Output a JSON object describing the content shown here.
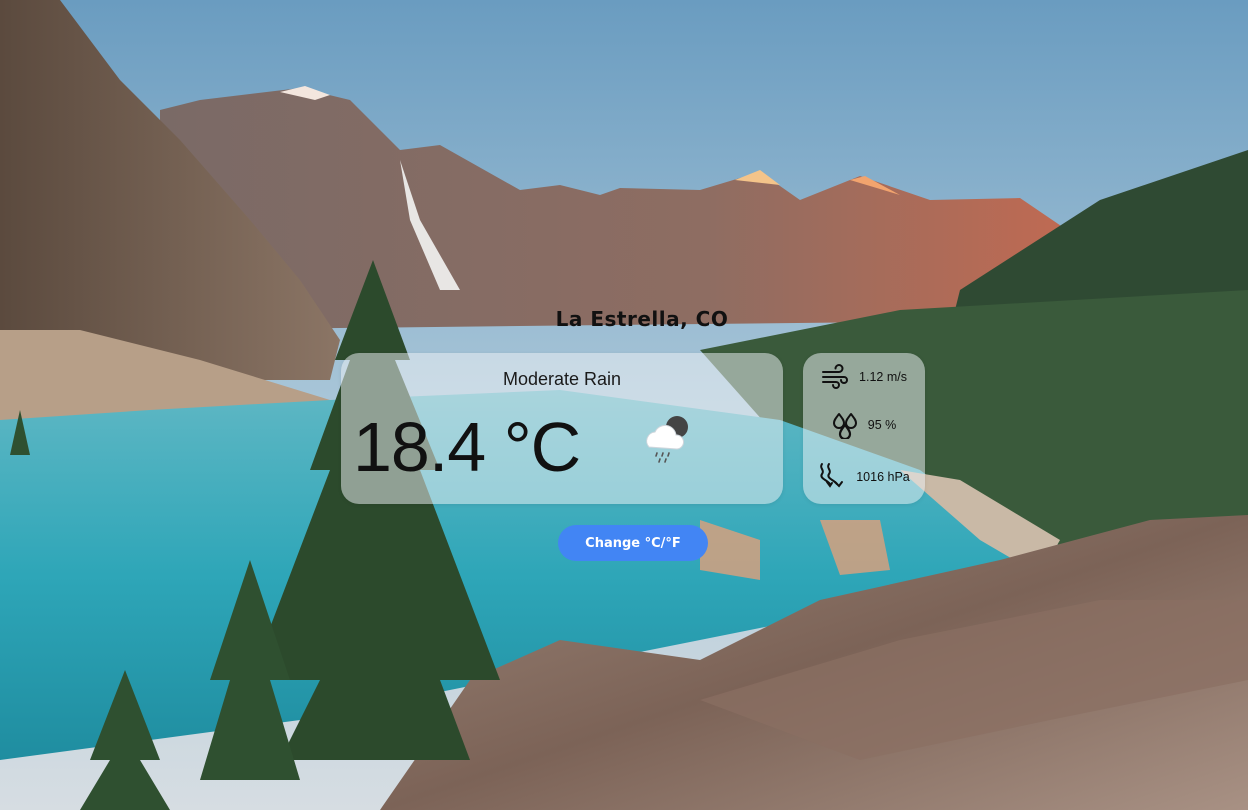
{
  "location": {
    "city_label": "La Estrella, CO"
  },
  "current": {
    "condition": "Moderate Rain",
    "temperature": "18.4 °C",
    "icon": "cloud-rain-moon-icon"
  },
  "details": {
    "wind": {
      "icon": "wind-icon",
      "value": "1.12 m/s"
    },
    "humidity": {
      "icon": "humidity-drops-icon",
      "value": "95 %"
    },
    "pressure": {
      "icon": "pressure-waves-icon",
      "value": "1016 hPa"
    }
  },
  "actions": {
    "change_units_label": "Change °C/°F",
    "accent_color": "#4285f4"
  },
  "background": {
    "scene": "mountain-lake-landscape"
  }
}
